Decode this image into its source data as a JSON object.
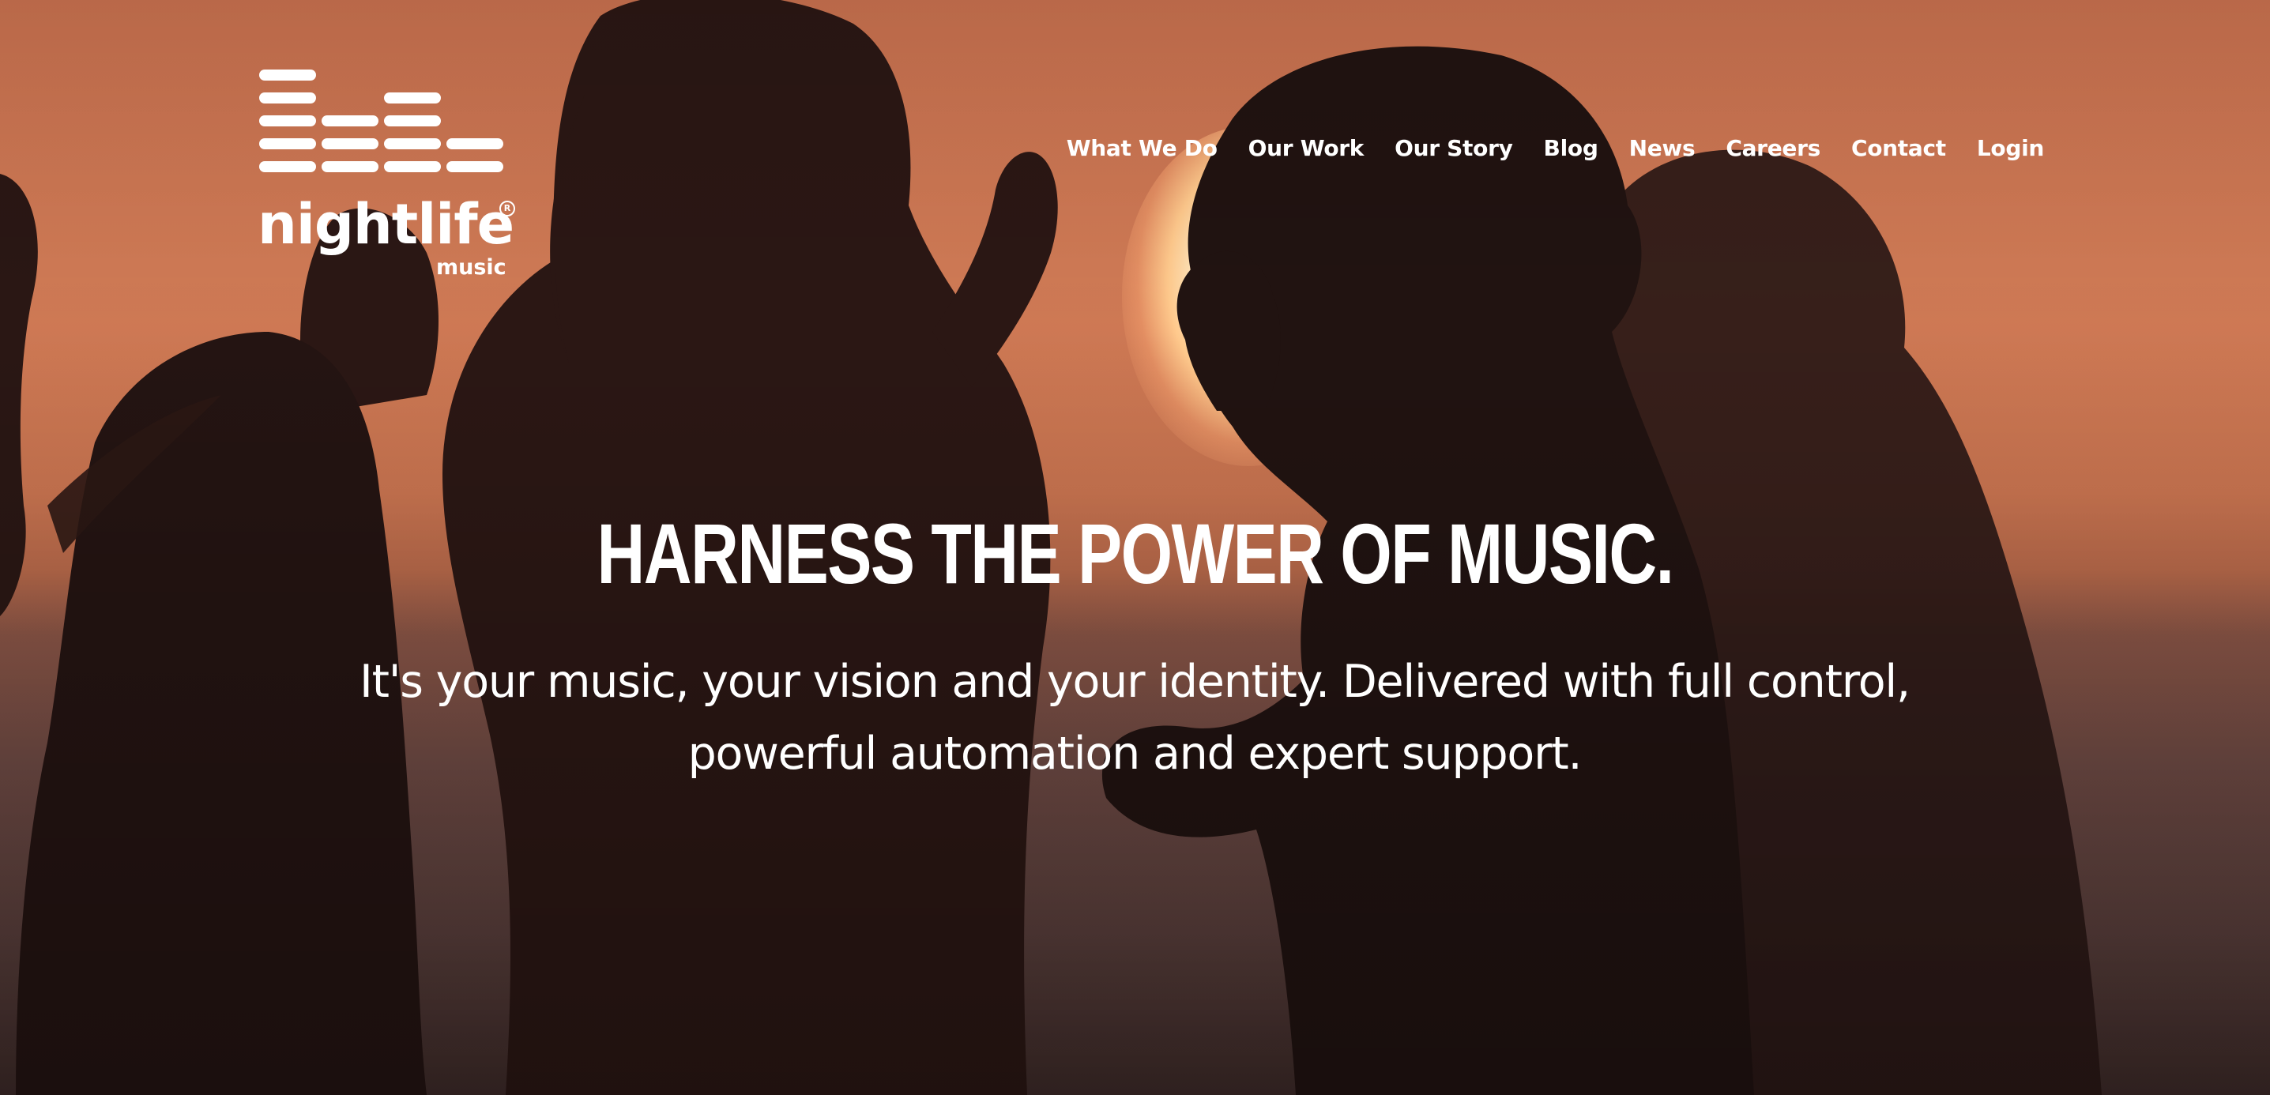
{
  "brand": {
    "name": "nightlife",
    "sub": "music",
    "registered_mark": "R"
  },
  "nav": {
    "items": [
      {
        "label": "What We Do"
      },
      {
        "label": "Our Work"
      },
      {
        "label": "Our Story"
      },
      {
        "label": "Blog"
      },
      {
        "label": "News"
      },
      {
        "label": "Careers"
      },
      {
        "label": "Contact"
      },
      {
        "label": "Login"
      }
    ]
  },
  "hero": {
    "headline": "HARNESS THE POWER OF MUSIC.",
    "subtext": "It's your music, your vision and your identity. Delivered with full control, powerful automation and expert support."
  },
  "colors": {
    "text": "#ffffff",
    "sky": "#cf7a55",
    "sea": "#6e4a44"
  }
}
